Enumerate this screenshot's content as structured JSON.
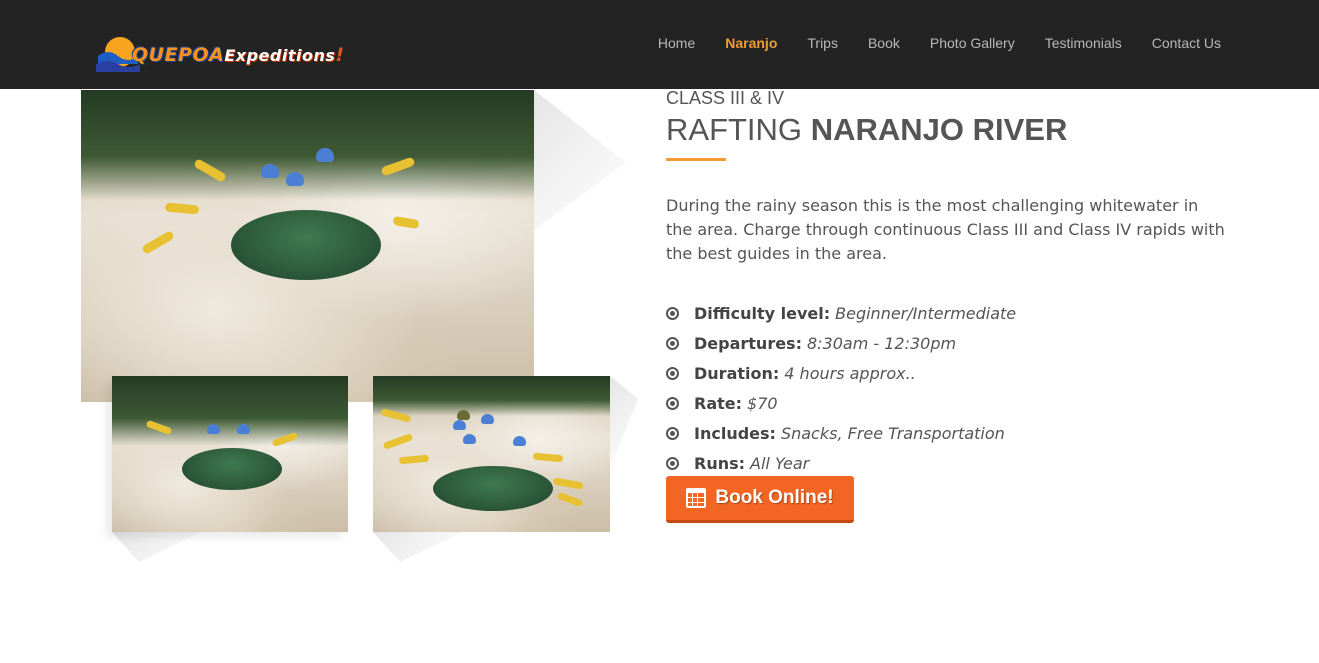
{
  "header": {
    "logo": {
      "part1": "QUEPOA",
      "part2": "Expeditions",
      "part3": "!"
    },
    "nav": [
      {
        "label": "Home",
        "active": false
      },
      {
        "label": "Naranjo",
        "active": true
      },
      {
        "label": "Trips",
        "active": false
      },
      {
        "label": "Book",
        "active": false
      },
      {
        "label": "Photo Gallery",
        "active": false
      },
      {
        "label": "Testimonials",
        "active": false
      },
      {
        "label": "Contact Us",
        "active": false
      }
    ]
  },
  "colors": {
    "header_bg": "#232323",
    "accent": "#f39c35",
    "button": "#f26522"
  },
  "main": {
    "subtitle": "CLASS III & IV",
    "title_light": "RAFTING",
    "title_bold": "NARANJO RIVER",
    "description": "During the rainy season this is the most challenging whitewater in the area. Charge through continuous Class III and Class IV rapids with the best guides in the area.",
    "facts": [
      {
        "label": "Difficulty level:",
        "value": "Beginner/Intermediate"
      },
      {
        "label": "Departures:",
        "value": "8:30am - 12:30pm"
      },
      {
        "label": "Duration:",
        "value": "4 hours approx.."
      },
      {
        "label": "Rate:",
        "value": "$70"
      },
      {
        "label": "Includes:",
        "value": "Snacks, Free Transportation"
      },
      {
        "label": "Runs:",
        "value": "All Year"
      }
    ],
    "book_button": {
      "label": "Book Online!",
      "icon": "calendar-icon"
    }
  }
}
